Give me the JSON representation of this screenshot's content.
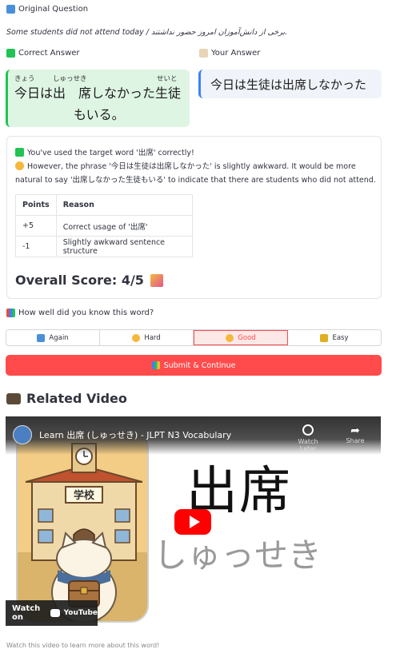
{
  "original": {
    "label": "Original Question",
    "icon": "book-icon",
    "text": "Some students did not attend today / برخی از دانش‌آموزان امروز حضور نداشتند."
  },
  "correct": {
    "label": "Correct Answer",
    "icon": "check-icon",
    "line1": "今日は出　席しなかった生徒",
    "line2": "もいる。",
    "furigana": [
      "きょう",
      "しゅっせき",
      "せいと"
    ]
  },
  "yours": {
    "label": "Your Answer",
    "icon": "memo-icon",
    "text": "今日は生徒は出席しなかった"
  },
  "feedback": {
    "line1": "You've used the target word '出席' correctly!",
    "line2": "However, the phrase '今日は生徒は出席しなかった' is slightly awkward. It would be more",
    "line3": "natural to say '出席しなかった生徒もいる' to indicate that there are students who did not attend.",
    "table": {
      "headers": [
        "Points",
        "Reason"
      ],
      "rows": [
        [
          "+5",
          "Correct usage of '出席'"
        ],
        [
          "-1",
          "Slightly awkward sentence structure"
        ]
      ]
    },
    "score": "Overall Score: 4/5"
  },
  "rating": {
    "question": "How well did you know this word?",
    "options": [
      "Again",
      "Hard",
      "Good",
      "Easy"
    ],
    "selected": "Good"
  },
  "submit_label": "Submit & Continue",
  "related": {
    "title": "Related Video",
    "video_title": "Learn 出席 (しゅっせき) - JLPT N3 Vocabulary",
    "watch_later": "Watch Later",
    "share": "Share",
    "kanji": "出席",
    "kana": "しゅっせき",
    "sign": "学校",
    "watch_on": "Watch on",
    "youtube": "YouTube",
    "caption": "Watch this video to learn more about this word!"
  },
  "colors": {
    "accent": "#ff4b4b",
    "correct_bg": "#dff5e4",
    "correct_border": "#21c354",
    "your_border": "#3b82f6"
  }
}
